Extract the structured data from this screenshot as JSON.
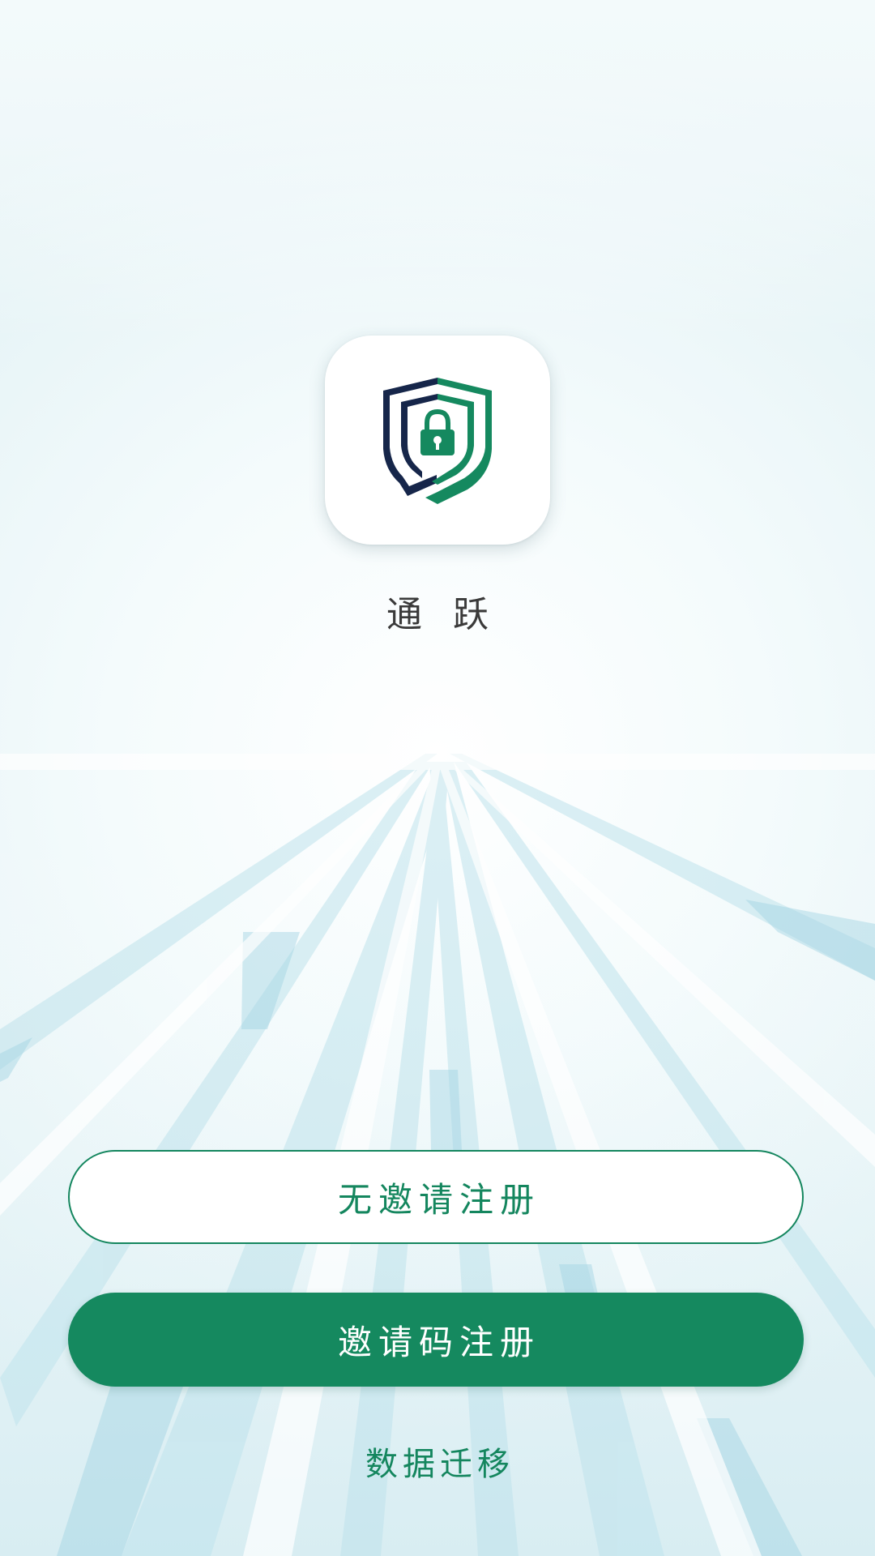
{
  "app": {
    "name": "通 跃",
    "icon": "shield-lock-icon"
  },
  "buttons": {
    "no_invite_register": "无邀请注册",
    "invite_code_register": "邀请码注册"
  },
  "links": {
    "data_migration": "数据迁移"
  },
  "colors": {
    "brand_green": "#15895f",
    "brand_navy": "#16264a",
    "text_gray": "#3a3a3a"
  }
}
